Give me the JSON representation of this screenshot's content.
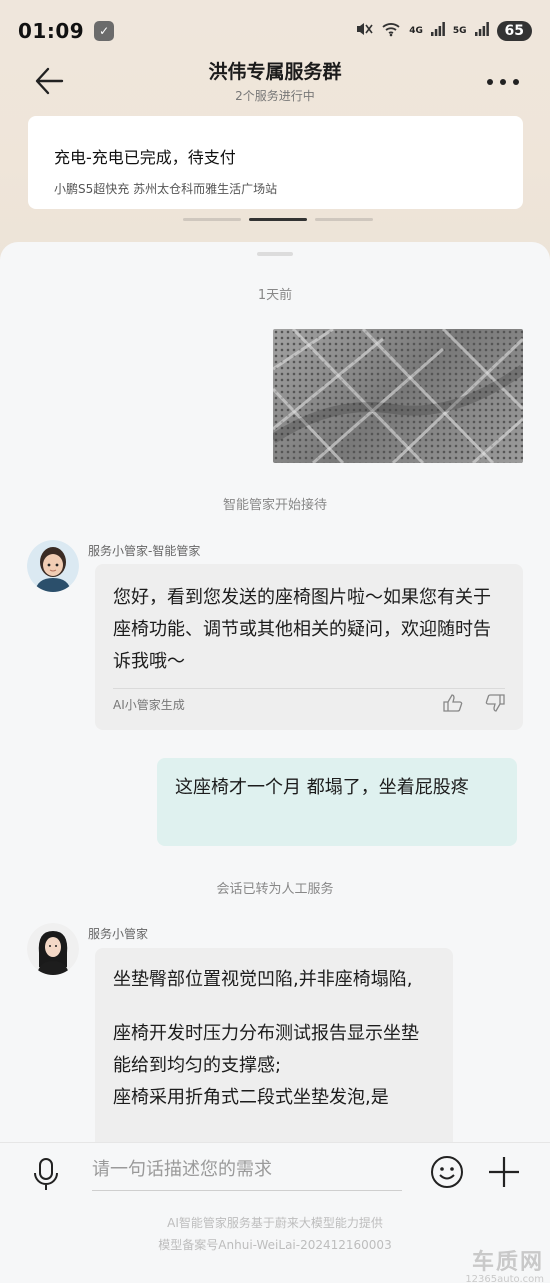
{
  "status_bar": {
    "time": "01:09",
    "network_labels": [
      "4G",
      "5G"
    ],
    "battery": "65"
  },
  "header": {
    "title": "洪伟专属服务群",
    "subtitle": "2个服务进行中"
  },
  "service_card": {
    "title": "充电-充电已完成，待支付",
    "subtitle": "小鹏S5超快充 苏州太仓科而雅生活广场站"
  },
  "pager": {
    "count": 3,
    "active": 1
  },
  "chat": {
    "time_separator": "1天前",
    "system_notice_1": "智能管家开始接待",
    "assistant_name": "服务小管家-智能管家",
    "assistant_message": "您好，看到您发送的座椅图片啦～如果您有关于座椅功能、调节或其他相关的疑问，欢迎随时告诉我哦～",
    "ai_footer": "AI小管家生成",
    "user_message": "这座椅才一个月 都塌了，坐着屁股疼",
    "system_notice_2": "会话已转为人工服务",
    "agent_name": "服务小管家",
    "agent_message_p1": "坐垫臀部位置视觉凹陷,并非座椅塌陷,",
    "agent_message_p2": "座椅开发时压力分布测试报告显示坐垫能给到均匀的支撑感;",
    "agent_message_p3": "座椅采用折角式二段式坐垫发泡,是"
  },
  "input_bar": {
    "placeholder": "请一句话描述您的需求"
  },
  "footnotes": {
    "line1": "AI智能管家服务基于蔚来大模型能力提供",
    "line2": "模型备案号Anhui-WeiLai-202412160003"
  },
  "watermark": {
    "main": "车质网",
    "sub": "12365auto.com"
  },
  "icons": {
    "back": "back-arrow-icon",
    "more": "more-icon",
    "mic": "microphone-icon",
    "emoji": "emoji-icon",
    "plus": "plus-icon",
    "like": "thumbs-up-icon",
    "dislike": "thumbs-down-icon"
  }
}
